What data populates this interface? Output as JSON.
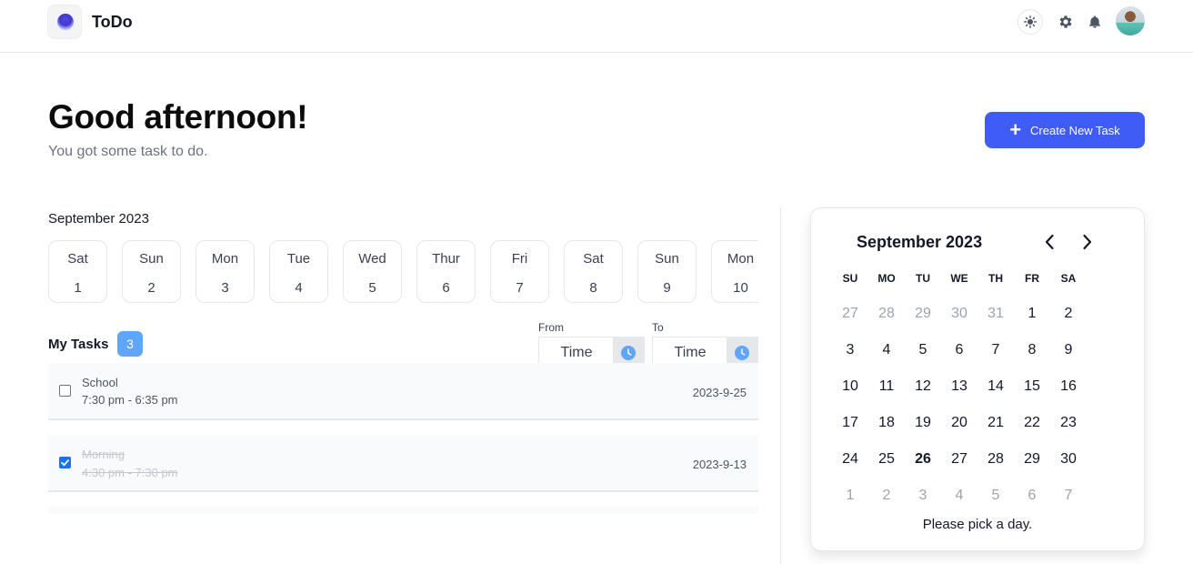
{
  "header": {
    "app_title": "ToDo",
    "icons": [
      "theme-toggle-icon",
      "gear-icon",
      "bell-icon"
    ]
  },
  "greeting": {
    "title": "Good afternoon!",
    "subtitle": "You got some task to do."
  },
  "create_button": {
    "label": "Create New Task",
    "icon": "plus-icon",
    "color": "#3f5cf6"
  },
  "day_strip": {
    "month": "September 2023",
    "days": [
      {
        "name": "Sat",
        "num": "1"
      },
      {
        "name": "Sun",
        "num": "2"
      },
      {
        "name": "Mon",
        "num": "3"
      },
      {
        "name": "Tue",
        "num": "4"
      },
      {
        "name": "Wed",
        "num": "5"
      },
      {
        "name": "Thur",
        "num": "6"
      },
      {
        "name": "Fri",
        "num": "7"
      },
      {
        "name": "Sat",
        "num": "8"
      },
      {
        "name": "Sun",
        "num": "9"
      },
      {
        "name": "Mon",
        "num": "10"
      }
    ]
  },
  "tasks": {
    "title": "My Tasks",
    "count": "3",
    "from_label": "From",
    "to_label": "To",
    "from_value": "Time",
    "to_value": "Time",
    "items": [
      {
        "name": "School",
        "time": "7:30 pm - 6:35 pm",
        "date": "2023-9-25",
        "done": false
      },
      {
        "name": "Morning",
        "time": "4:30 pm - 7:30 pm",
        "date": "2023-9-13",
        "done": true
      }
    ]
  },
  "calendar": {
    "title": "September 2023",
    "weekdays": [
      "SU",
      "MO",
      "TU",
      "WE",
      "TH",
      "FR",
      "SA"
    ],
    "weeks": [
      [
        "27",
        "28",
        "29",
        "30",
        "31",
        "1",
        "2"
      ],
      [
        "3",
        "4",
        "5",
        "6",
        "7",
        "8",
        "9"
      ],
      [
        "10",
        "11",
        "12",
        "13",
        "14",
        "15",
        "16"
      ],
      [
        "17",
        "18",
        "19",
        "20",
        "21",
        "22",
        "23"
      ],
      [
        "24",
        "25",
        "26",
        "27",
        "28",
        "29",
        "30"
      ],
      [
        "1",
        "2",
        "3",
        "4",
        "5",
        "6",
        "7"
      ]
    ],
    "today": "26",
    "footer": "Please pick a day.",
    "accent": "#3f5cf6"
  }
}
